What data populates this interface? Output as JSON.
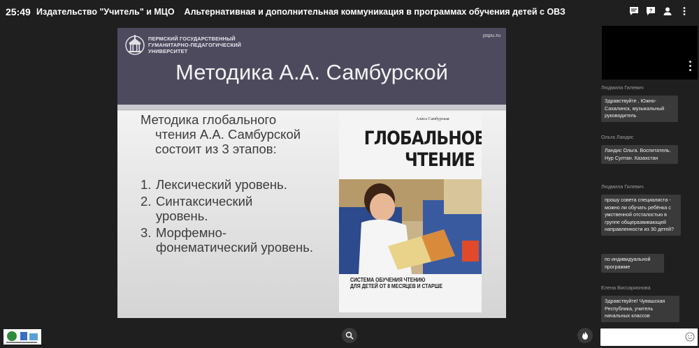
{
  "header": {
    "timer": "25:49",
    "title": "Издательство \"Учитель\" и МЦО    Альтернативная и дополнительная коммуникация в программах обучения детей с ОВЗ",
    "icons": [
      "chat-icon",
      "help-icon",
      "user-icon",
      "more-icon"
    ]
  },
  "slide": {
    "university": [
      "ПЕРМСКИЙ ГОСУДАРСТВЕННЫЙ",
      "ГУМАНИТАРНО-ПЕДАГОГИЧЕСКИЙ",
      "УНИВЕРСИТЕТ"
    ],
    "site": "pspu.ru",
    "title": "Методика А.А. Самбурской",
    "intro_first": "Методика глобального",
    "intro_rest": "чтения А.А. Самбурской состоит из 3 этапов:",
    "steps": [
      {
        "num": "1.",
        "first": "Лексический уровень.",
        "rest": ""
      },
      {
        "num": "2.",
        "first": "Синтаксический",
        "rest": "уровень."
      },
      {
        "num": "3.",
        "first": "Морфемно-",
        "rest": "фонематический уровень."
      }
    ],
    "book": {
      "author": "Алиса Самбурская",
      "title_line1": "ГЛОБАЛЬНОЕ",
      "title_line2": "ЧТЕНИЕ",
      "subtitle_line1": "СИСТЕМА ОБУЧЕНИЯ ЧТЕНИЮ",
      "subtitle_line2": "ДЛЯ ДЕТЕЙ ОТ 8 МЕСЯЦЕВ И СТАРШЕ"
    }
  },
  "chat": {
    "messages": [
      {
        "author": "Людмила Гилевич",
        "texts": [
          "Здравствуйте , Южно-Сахалинск, музыкальный руководитель"
        ]
      },
      {
        "author": "Ольга Ландис",
        "texts": [
          "Ландис Ольга. Воспитатель. Нур Султан. Казахстан"
        ]
      },
      {
        "author": "Людмила Гилевич",
        "texts": [
          "прошу совета специалиста - можно ли обучать ребёнка с умственной отсталостью в группе общеразвивающей направленности  из 30 детей?",
          "по индивидуальной программе"
        ]
      },
      {
        "author": "Елена Виссарионова",
        "texts": [
          "Здравствуйте! Чувашская Республика, учитель начальных классов"
        ]
      }
    ],
    "input_placeholder": ""
  },
  "colors": {
    "background": "#1f1f1f",
    "slide_header": "#4e4a5e",
    "message_bubble": "#3a3a3a"
  }
}
